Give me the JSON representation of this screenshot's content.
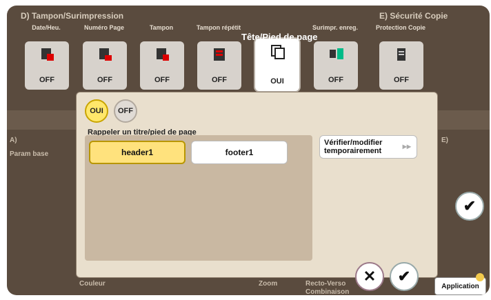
{
  "groups": {
    "d_label": "D) Tampon/Surimpression",
    "e_label": "E) Sécurité Copie"
  },
  "functions": [
    {
      "name": "date-heure",
      "label": "Date/Heu.",
      "status": "OFF",
      "icon": "stamp-date-icon"
    },
    {
      "name": "numero-page",
      "label": "Numéro Page",
      "status": "OFF",
      "icon": "page-number-icon"
    },
    {
      "name": "tampon",
      "label": "Tampon",
      "status": "OFF",
      "icon": "stamp-icon"
    },
    {
      "name": "tampon-repetition",
      "label": "Tampon répétit",
      "status": "OFF",
      "icon": "repeat-stamp-icon"
    },
    {
      "name": "tete-pied-page",
      "label": "Tête/Pied de page",
      "status": "OUI",
      "icon": "header-footer-icon"
    },
    {
      "name": "surimpr-enreg",
      "label": "Surimpr. enreg.",
      "status": "OFF",
      "icon": "overlay-icon"
    },
    {
      "name": "protection-copie",
      "label": "Protection Copie",
      "status": "OFF",
      "icon": "copy-protect-icon"
    }
  ],
  "dialog": {
    "title": "Tête/Pied de page",
    "toggle_on": "OUI",
    "toggle_off": "OFF",
    "subtitle": "Rappeler un titre/pied de page",
    "header_btn": "header1",
    "footer_btn": "footer1",
    "verify_btn": "Vérifier/modifier temporairement"
  },
  "background": {
    "a_label": "A)",
    "a_sub": "Param base",
    "e_short": "E)",
    "couleur": "Couleur",
    "zoom": "Zoom",
    "recto": "Recto-Verso",
    "combinaison": "Combinaison",
    "application": "Application"
  },
  "colors": {
    "selected": "#ffe27d",
    "panel": "#5a4b3e",
    "dialog": "#e9dfcd"
  }
}
